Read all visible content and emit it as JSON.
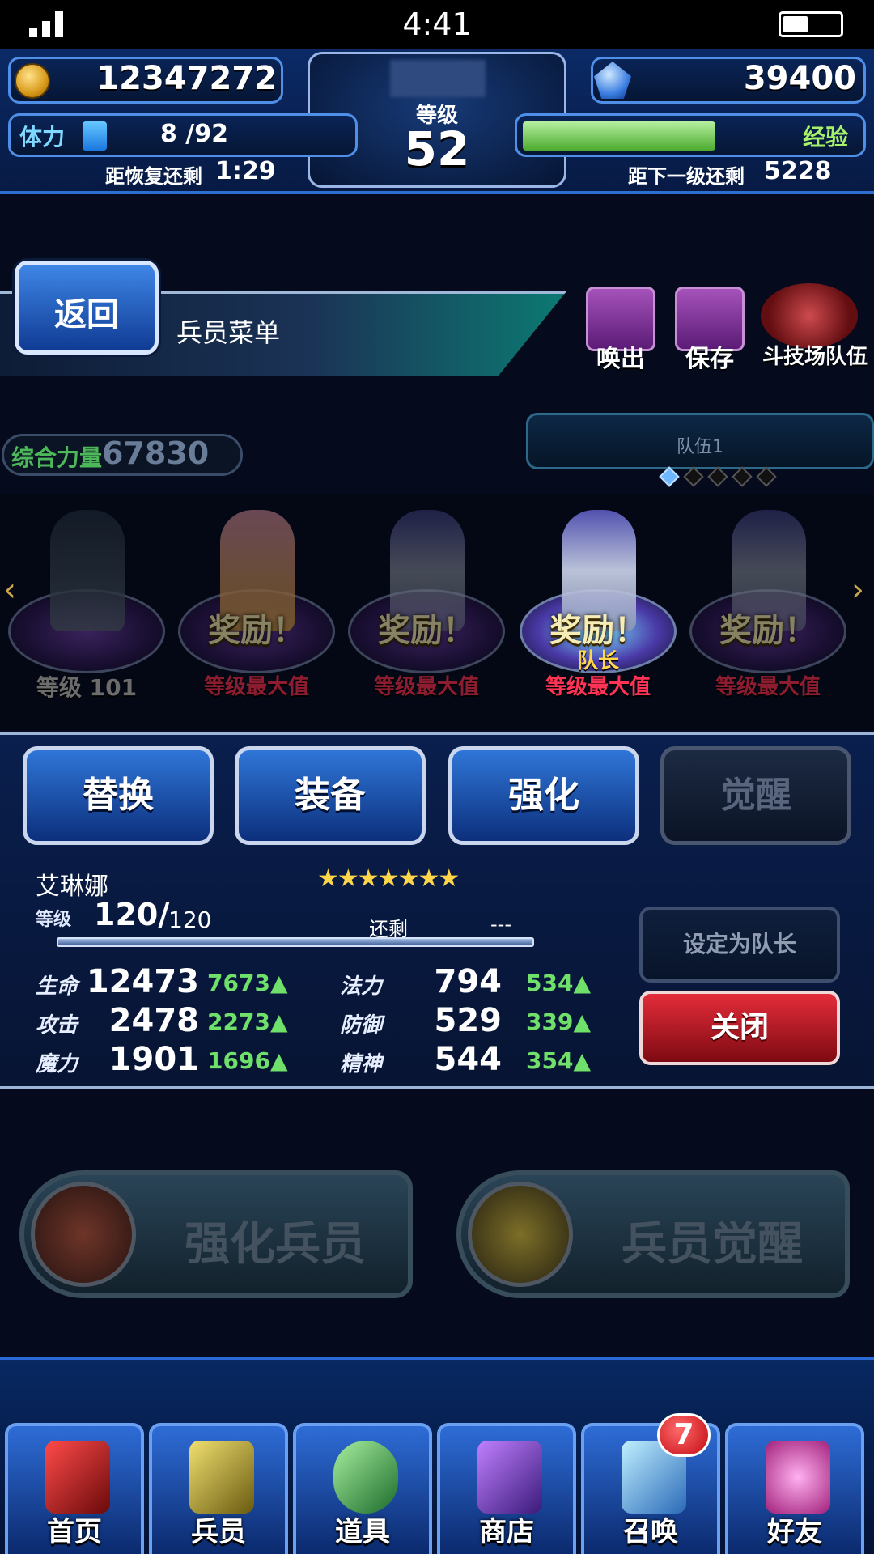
{
  "status_bar": {
    "time": "4:41"
  },
  "hud": {
    "gold": "12347272",
    "gems": "39400",
    "level_label": "等级",
    "level": "52",
    "stamina_label": "体力",
    "stamina": "8 /92",
    "stamina_fill": 0.087,
    "stamina_recover_label": "距恢复还剩",
    "stamina_recover_time": "1:29",
    "exp_label": "经验",
    "exp_fill": 0.72,
    "next_level_label": "距下一级还剩",
    "next_level_value": "5228"
  },
  "header": {
    "back_label": "返回",
    "menu_title": "兵员菜单",
    "actions": [
      {
        "label": "唤出",
        "icon": "party-load-icon"
      },
      {
        "label": "保存",
        "icon": "party-save-icon"
      },
      {
        "label": "斗技场队伍",
        "icon": "arena-party-icon"
      }
    ]
  },
  "team": {
    "power_label": "综合力量",
    "power_value": "67830",
    "team_name": "队伍1",
    "page_count": 5,
    "active_page": 1
  },
  "units": [
    {
      "name": "unit-1",
      "reward": "",
      "status": "等级 101",
      "leader": ""
    },
    {
      "name": "unit-2",
      "reward": "奖励！",
      "status": "等级最大值",
      "leader": ""
    },
    {
      "name": "unit-3",
      "reward": "奖励！",
      "status": "等级最大值",
      "leader": ""
    },
    {
      "name": "unit-4",
      "reward": "奖励！",
      "status": "等级最大值",
      "leader": "队长"
    },
    {
      "name": "unit-5",
      "reward": "奖励！",
      "status": "等级最大值",
      "leader": ""
    }
  ],
  "detail": {
    "tabs": [
      "替换",
      "装备",
      "强化",
      "觉醒"
    ],
    "unit_name": "艾琳娜",
    "stars": "★★★★★★★",
    "level_label": "等级",
    "level_current": "120/",
    "level_max": "120",
    "remaining_label": "还剩",
    "remaining_value": "---",
    "stats": [
      {
        "label": "生命",
        "value": "12473",
        "bonus": "7673"
      },
      {
        "label": "法力",
        "value": "794",
        "bonus": "534"
      },
      {
        "label": "攻击",
        "value": "2478",
        "bonus": "2273"
      },
      {
        "label": "防御",
        "value": "529",
        "bonus": "339"
      },
      {
        "label": "魔力",
        "value": "1901",
        "bonus": "1696"
      },
      {
        "label": "精神",
        "value": "544",
        "bonus": "354"
      }
    ],
    "set_leader_label": "设定为队长",
    "close_label": "关闭"
  },
  "actions": {
    "enhance_label": "强化兵员",
    "awaken_label": "兵员觉醒"
  },
  "nav": {
    "items": [
      {
        "label": "首页",
        "icon": "home-swords-icon"
      },
      {
        "label": "兵员",
        "icon": "units-icon"
      },
      {
        "label": "道具",
        "icon": "potion-icon"
      },
      {
        "label": "商店",
        "icon": "shop-icon"
      },
      {
        "label": "召唤",
        "icon": "summon-crystal-icon"
      },
      {
        "label": "好友",
        "icon": "friends-icon"
      }
    ],
    "summon_badge": "7"
  },
  "colors": {
    "accent_blue": "#2f76d8",
    "close_red": "#e42c3a",
    "bonus_green": "#6fe06a",
    "max_level_red": "#ff3355"
  }
}
